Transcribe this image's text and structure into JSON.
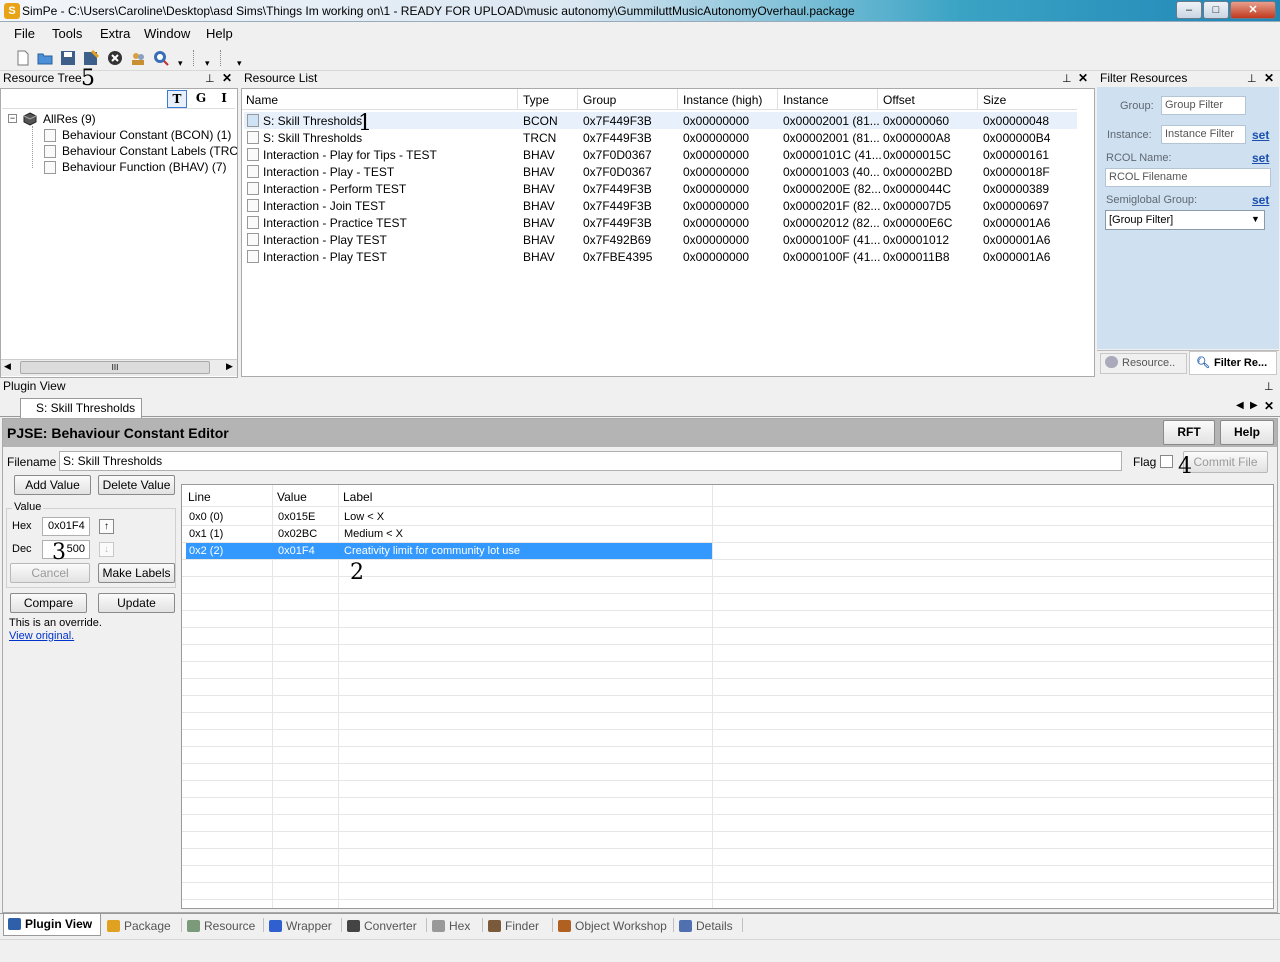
{
  "window": {
    "title": "SimPe - C:\\Users\\Caroline\\Desktop\\asd Sims\\Things Im working on\\1 - READY FOR UPLOAD\\music autonomy\\GummiluttMusicAutonomyOverhaul.package",
    "min_label": "–",
    "max_label": "□",
    "close_label": "✕"
  },
  "menu": [
    "File",
    "Tools",
    "Extra",
    "Window",
    "Help"
  ],
  "toolbar": {
    "icons": [
      "new-file-icon",
      "open-folder-icon",
      "save-icon",
      "save-as-icon",
      "close-file-icon",
      "users-icon",
      "refresh-icon"
    ]
  },
  "resource_tree": {
    "title": "Resource Tree",
    "view_buttons": [
      "T",
      "G",
      "I"
    ],
    "root": "AllRes (9)",
    "items": [
      "Behaviour Constant (BCON) (1)",
      "Behaviour Constant Labels (TRCN) (",
      "Behaviour Function (BHAV) (7)"
    ],
    "scroll_label": "III"
  },
  "resource_list": {
    "title": "Resource List",
    "columns": [
      "Name",
      "Type",
      "Group",
      "Instance (high)",
      "Instance",
      "Offset",
      "Size"
    ],
    "rows": [
      [
        "S: Skill Thresholds",
        "BCON",
        "0x7F449F3B",
        "0x00000000",
        "0x00002001 (81...",
        "0x00000060",
        "0x00000048"
      ],
      [
        "S: Skill Thresholds",
        "TRCN",
        "0x7F449F3B",
        "0x00000000",
        "0x00002001 (81...",
        "0x000000A8",
        "0x000000B4"
      ],
      [
        "Interaction - Play for Tips - TEST",
        "BHAV",
        "0x7F0D0367",
        "0x00000000",
        "0x0000101C (41...",
        "0x0000015C",
        "0x00000161"
      ],
      [
        "Interaction - Play - TEST",
        "BHAV",
        "0x7F0D0367",
        "0x00000000",
        "0x00001003 (40...",
        "0x000002BD",
        "0x0000018F"
      ],
      [
        "Interaction - Perform TEST",
        "BHAV",
        "0x7F449F3B",
        "0x00000000",
        "0x0000200E (82...",
        "0x0000044C",
        "0x00000389"
      ],
      [
        "Interaction - Join TEST",
        "BHAV",
        "0x7F449F3B",
        "0x00000000",
        "0x0000201F (82...",
        "0x000007D5",
        "0x00000697"
      ],
      [
        "Interaction - Practice TEST",
        "BHAV",
        "0x7F449F3B",
        "0x00000000",
        "0x00002012 (82...",
        "0x00000E6C",
        "0x000001A6"
      ],
      [
        "Interaction - Play TEST",
        "BHAV",
        "0x7F492B69",
        "0x00000000",
        "0x0000100F (41...",
        "0x00001012",
        "0x000001A6"
      ],
      [
        "Interaction - Play TEST",
        "BHAV",
        "0x7FBE4395",
        "0x00000000",
        "0x0000100F (41...",
        "0x000011B8",
        "0x000001A6"
      ]
    ]
  },
  "filter": {
    "title": "Filter Resources",
    "group_label": "Group:",
    "group_placeholder": "Group Filter",
    "instance_label": "Instance:",
    "instance_placeholder": "Instance Filter",
    "set_label": "set",
    "rcol_label": "RCOL Name:",
    "rcol_placeholder": "RCOL Filename",
    "semiglobal_label": "Semiglobal Group:",
    "semiglobal_value": "[Group Filter]",
    "tab_resource": "Resource..",
    "tab_filter": "Filter Re..."
  },
  "plugin_view": {
    "title": "Plugin View",
    "doc_tab": "S: Skill Thresholds",
    "editor_title": "PJSE: Behaviour Constant Editor",
    "rft_label": "RFT",
    "help_label": "Help",
    "filename_label": "Filename",
    "filename_value": "S: Skill Thresholds",
    "flag_label": "Flag",
    "commit_label": "Commit File",
    "add_value_label": "Add Value",
    "delete_value_label": "Delete Value",
    "value_group_label": "Value",
    "hex_label": "Hex",
    "hex_value": "0x01F4",
    "dec_label": "Dec",
    "dec_value": "500",
    "cancel_label": "Cancel",
    "make_labels_label": "Make Labels",
    "compare_label": "Compare",
    "update_label": "Update",
    "override_text": "This is an override.",
    "view_original_text": "View original.",
    "table_columns": [
      "Line",
      "Value",
      "Label"
    ],
    "table_rows": [
      [
        "0x0 (0)",
        "0x015E",
        "Low < X"
      ],
      [
        "0x1 (1)",
        "0x02BC",
        "Medium < X"
      ],
      [
        "0x2 (2)",
        "0x01F4",
        "Creativity limit for community lot use"
      ]
    ]
  },
  "annotations": [
    "1",
    "2",
    "3",
    "4",
    "5"
  ],
  "bottom_tabs": [
    "Plugin View",
    "Package",
    "Resource",
    "Wrapper",
    "Converter",
    "Hex",
    "Finder",
    "Object Workshop",
    "Details"
  ],
  "colors": {
    "selection": "#3399ff",
    "filter_panel_bg": "#cfe0f0",
    "link": "#1a4fb0",
    "editor_header_bg": "#b4b4b4"
  }
}
